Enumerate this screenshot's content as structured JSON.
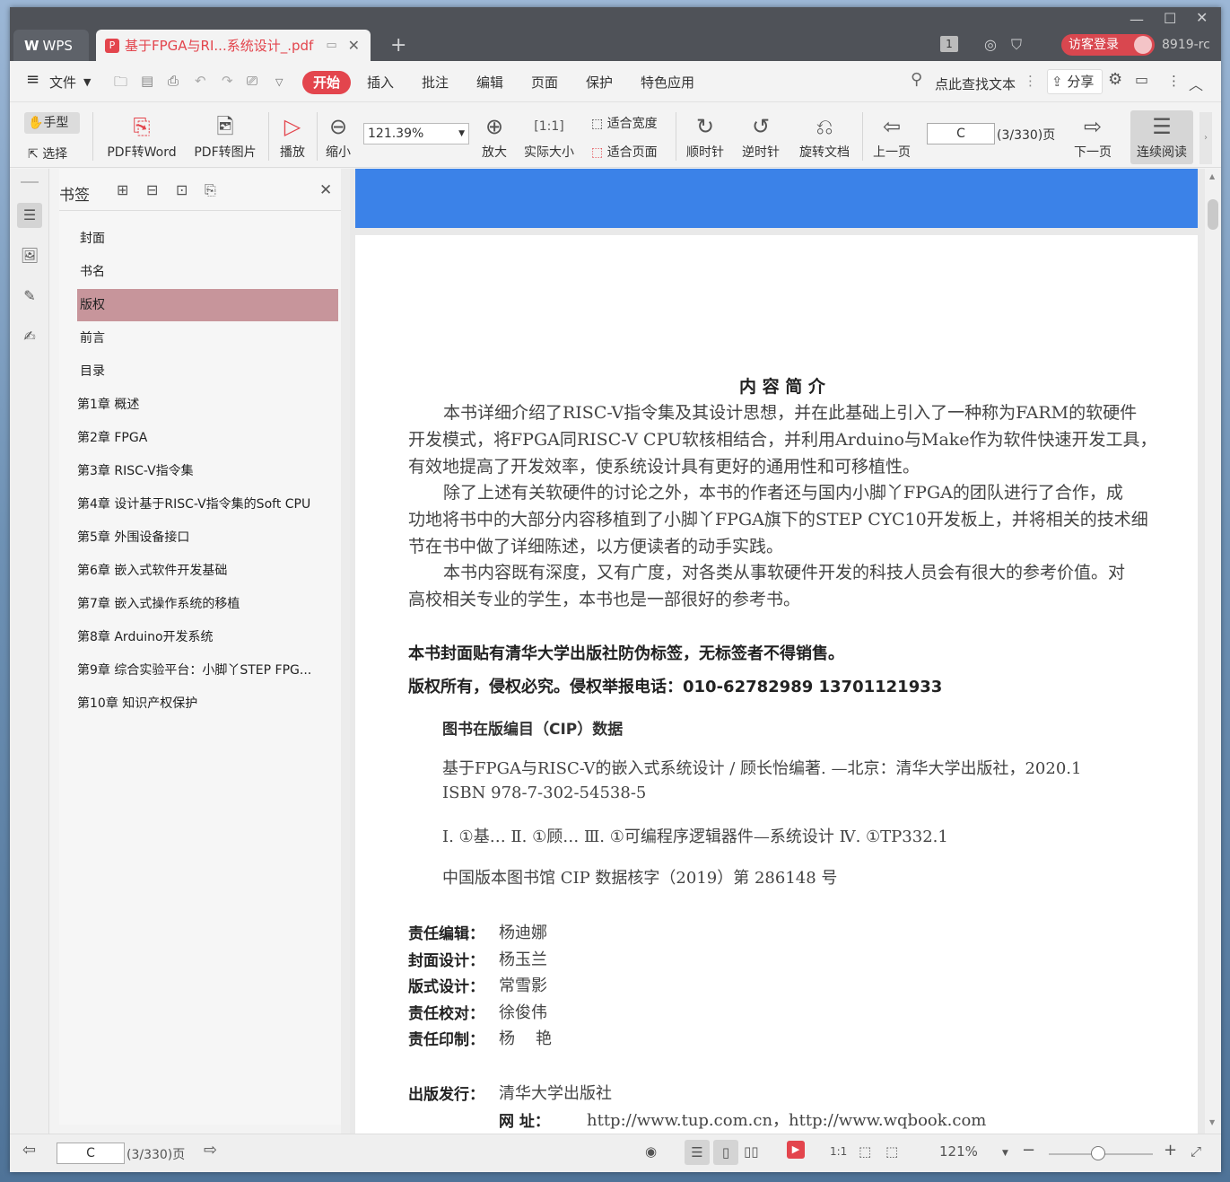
{
  "tabs": {
    "app": "WPS",
    "document": "基于FPGA与RI...系统设计_.pdf"
  },
  "titlebar": {
    "badge": "1",
    "login": "访客登录",
    "user": "8919-rc"
  },
  "menu": {
    "file": "文件",
    "items": [
      "开始",
      "插入",
      "批注",
      "编辑",
      "页面",
      "保护",
      "特色应用"
    ],
    "search": "点此查找文本",
    "share": "分享"
  },
  "toolbar": {
    "hand": "手型",
    "select": "选择",
    "pdf2word": "PDF转Word",
    "pdf2img": "PDF转图片",
    "play": "播放",
    "zoomout": "缩小",
    "zoom": "121.39%",
    "zoomin": "放大",
    "actual": "实际大小",
    "fitwidth": "适合宽度",
    "fitpage": "适合页面",
    "cw": "顺时针",
    "ccw": "逆时针",
    "rotate": "旋转文档",
    "prev": "上一页",
    "page": "C",
    "pageinfo": "(3/330)页",
    "next": "下一页",
    "continuous": "连续阅读"
  },
  "bookmarks": {
    "title": "书签",
    "items": [
      {
        "label": "封面",
        "expandable": false
      },
      {
        "label": "书名",
        "expandable": false
      },
      {
        "label": "版权",
        "expandable": false,
        "selected": true
      },
      {
        "label": "前言",
        "expandable": false
      },
      {
        "label": "目录",
        "expandable": false
      },
      {
        "label": "第1章  概述",
        "expandable": true
      },
      {
        "label": "第2章  FPGA",
        "expandable": true
      },
      {
        "label": "第3章  RISC-V指令集",
        "expandable": true
      },
      {
        "label": "第4章  设计基于RISC-V指令集的Soft CPU",
        "expandable": true
      },
      {
        "label": "第5章  外围设备接口",
        "expandable": true
      },
      {
        "label": "第6章  嵌入式软件开发基础",
        "expandable": true
      },
      {
        "label": "第7章  嵌入式操作系统的移植",
        "expandable": true
      },
      {
        "label": "第8章  Arduino开发系统",
        "expandable": true
      },
      {
        "label": "第9章  综合实验平台：小脚丫STEP FPG...",
        "expandable": true
      },
      {
        "label": "第10章  知识产权保护",
        "expandable": true
      }
    ]
  },
  "doc": {
    "heading": "内 容 简 介",
    "para1": [
      "本书详细介绍了RISC-V指令集及其设计思想，并在此基础上引入了一种称为FARM的软硬件",
      "开发模式，将FPGA同RISC-V CPU软核相结合，并利用Arduino与Make作为软件快速开发工具，",
      "有效地提高了开发效率，使系统设计具有更好的通用性和可移植性。"
    ],
    "para2": [
      "除了上述有关软硬件的讨论之外，本书的作者还与国内小脚丫FPGA的团队进行了合作，成",
      "功地将书中的大部分内容移植到了小脚丫FPGA旗下的STEP CYC10开发板上，并将相关的技术细",
      "节在书中做了详细陈述，以方便读者的动手实践。"
    ],
    "para3": [
      "本书内容既有深度，又有广度，对各类从事软硬件开发的科技人员会有很大的参考价值。对",
      "高校相关专业的学生，本书也是一部很好的参考书。"
    ],
    "notice1": "本书封面贴有清华大学出版社防伪标签，无标签者不得销售。",
    "notice2": "版权所有，侵权必究。侵权举报电话：010-62782989  13701121933",
    "cip_title": "图书在版编目（CIP）数据",
    "cip1": "基于FPGA与RISC-V的嵌入式系统设计 / 顾长怡编著. —北京：清华大学出版社，2020.1",
    "cip2": "ISBN 978-7-302-54538-5",
    "cip3": "Ⅰ. ①基…   Ⅱ. ①顾…   Ⅲ. ①可编程序逻辑器件—系统设计   Ⅳ. ①TP332.1",
    "cip4": "中国版本图书馆 CIP 数据核字（2019）第 286148 号",
    "staff": [
      {
        "role": "责任编辑：",
        "name": "杨迪娜"
      },
      {
        "role": "封面设计：",
        "name": "杨玉兰"
      },
      {
        "role": "版式设计：",
        "name": "常雪影"
      },
      {
        "role": "责任校对：",
        "name": "徐俊伟"
      },
      {
        "role": "责任印制：",
        "name": "杨    艳"
      }
    ],
    "publisher_label": "出版发行：",
    "publisher": "清华大学出版社",
    "url_label": "网      址：",
    "url": "http://www.tup.com.cn，http://www.wqbook.com"
  },
  "status": {
    "page": "C",
    "pageinfo": "(3/330)页",
    "zoom": "121%"
  },
  "colors": {
    "accent": "#e3454d",
    "selected_bookmark": "#c7959b",
    "blue_page": "#3b82e8"
  }
}
